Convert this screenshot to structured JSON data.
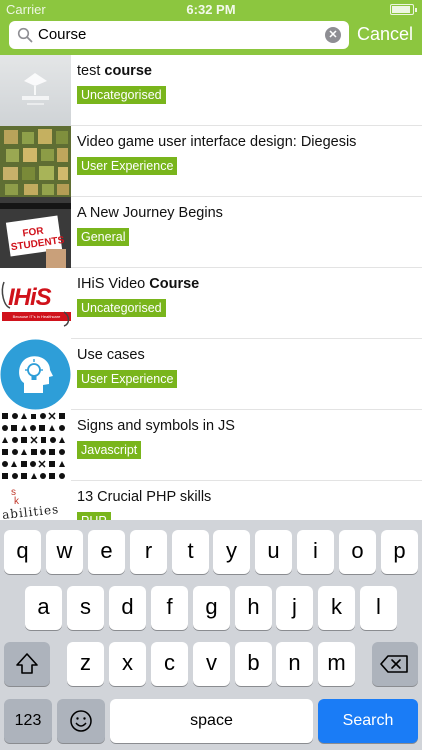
{
  "status_bar": {
    "carrier": "Carrier",
    "time": "6:32 PM"
  },
  "search": {
    "value": "Course",
    "cancel_label": "Cancel"
  },
  "colors": {
    "accent": "#8cc63f",
    "tag": "#79b51c",
    "search_key": "#1a7cf6"
  },
  "results": [
    {
      "title_before": "test ",
      "title_bold": "course",
      "title_after": "",
      "tag": "Uncategorised",
      "thumb": "coursepad"
    },
    {
      "title_before": "Video game user interface design: Diegesis",
      "title_bold": "",
      "title_after": "",
      "tag": "User Experience",
      "thumb": "game"
    },
    {
      "title_before": "A New Journey Begins",
      "title_bold": "",
      "title_after": "",
      "tag": "General",
      "thumb": "students",
      "thumb_text": "FOR STUDENTS"
    },
    {
      "title_before": "IHiS Video ",
      "title_bold": "Course",
      "title_after": "",
      "tag": "Uncategorised",
      "thumb": "ihis",
      "thumb_text": "IHiS",
      "thumb_subtext": "Because IT's in Healthcare"
    },
    {
      "title_before": "Use cases",
      "title_bold": "",
      "title_after": "",
      "tag": "User Experience",
      "thumb": "bulb"
    },
    {
      "title_before": "Signs and symbols in JS",
      "title_bold": "",
      "title_after": "",
      "tag": "Javascript",
      "thumb": "symbols"
    },
    {
      "title_before": "13 Crucial PHP skills",
      "title_bold": "",
      "title_after": "",
      "tag": "PHP",
      "thumb": "skills",
      "thumb_text": "abilities"
    }
  ],
  "keyboard": {
    "row1": [
      "q",
      "w",
      "e",
      "r",
      "t",
      "y",
      "u",
      "i",
      "o",
      "p"
    ],
    "row2": [
      "a",
      "s",
      "d",
      "f",
      "g",
      "h",
      "j",
      "k",
      "l"
    ],
    "row3": [
      "z",
      "x",
      "c",
      "v",
      "b",
      "n",
      "m"
    ],
    "numbers_label": "123",
    "space_label": "space",
    "search_label": "Search"
  }
}
